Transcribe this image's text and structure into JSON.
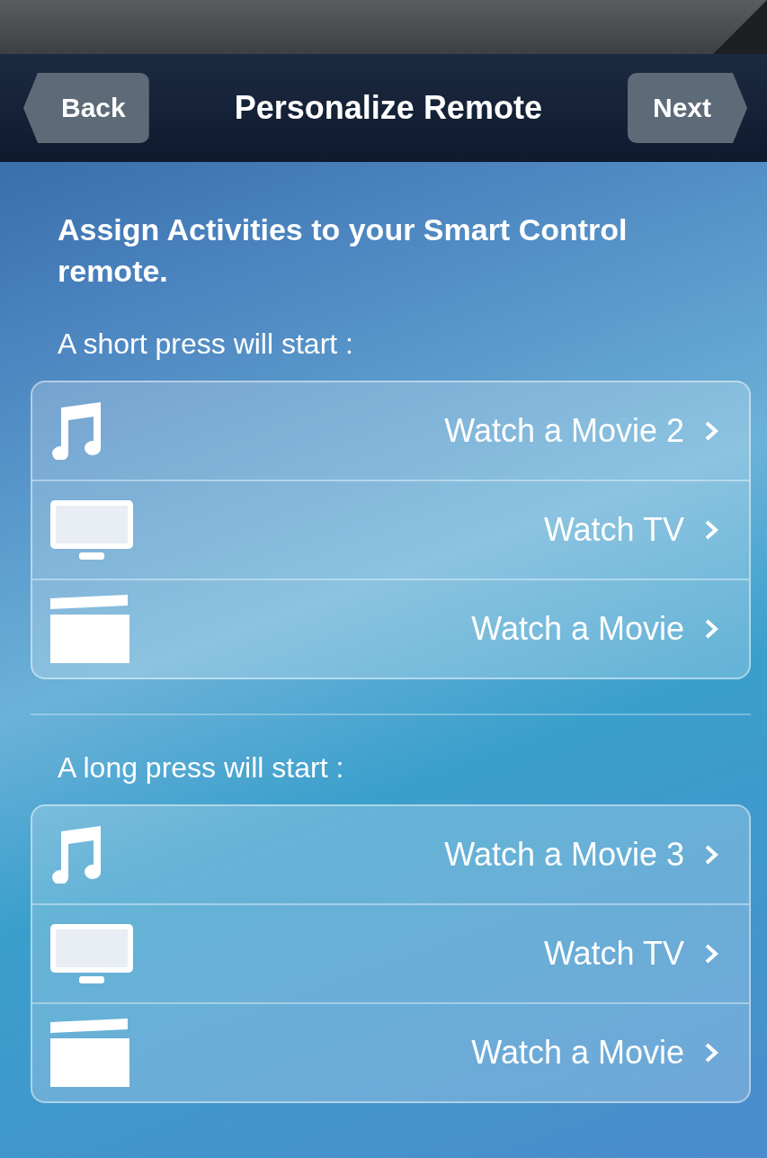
{
  "nav_bar": {
    "back": "Back",
    "title": "Personalize Remote",
    "next": "Next"
  },
  "heading": "Assign Activities to your Smart Control remote.",
  "sections": [
    {
      "label": "A short press will start :",
      "rows": [
        {
          "kind": "music",
          "text": "Watch a Movie 2"
        },
        {
          "kind": "tv",
          "text": "Watch TV"
        },
        {
          "kind": "movie",
          "text": "Watch a Movie"
        }
      ]
    },
    {
      "label": "A long press will start :",
      "rows": [
        {
          "kind": "music",
          "text": "Watch a Movie 3"
        },
        {
          "kind": "tv",
          "text": "Watch TV"
        },
        {
          "kind": "movie",
          "text": "Watch a Movie"
        }
      ]
    }
  ]
}
